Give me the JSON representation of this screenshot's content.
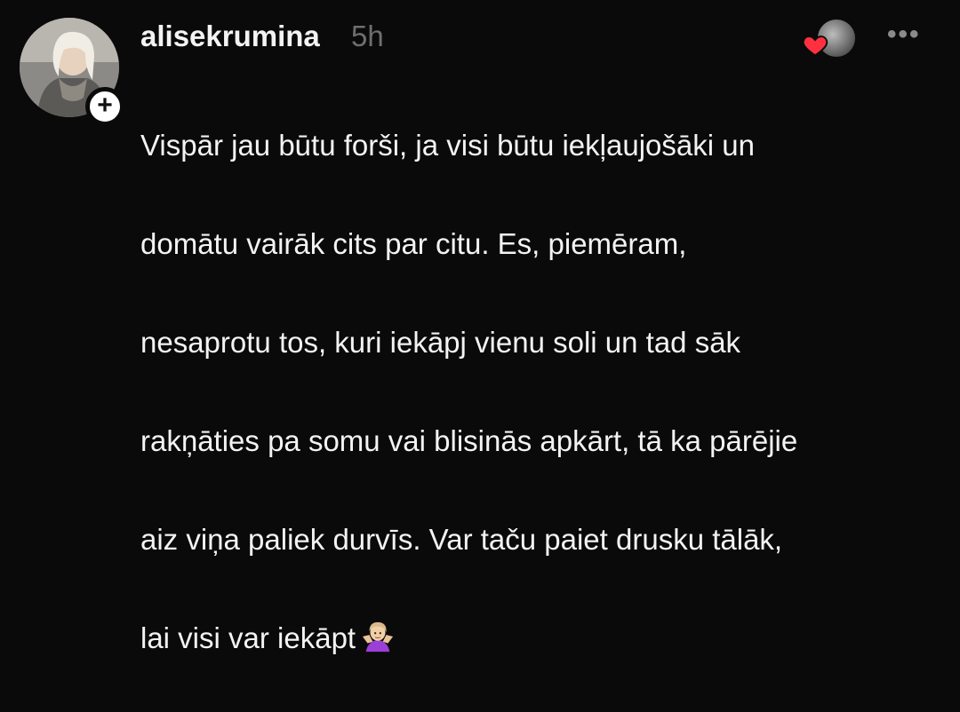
{
  "post": {
    "username": "alisekrumina",
    "timestamp": "5h",
    "more_label": "•••",
    "follow_label": "+",
    "body_lines": [
      "Vispār jau būtu forši, ja visi būtu iekļaujošāki un",
      "domātu vairāk cits par citu. Es, piemēram,",
      "nesaprotu tos, kuri iekāpj vienu soli un tad sāk",
      "rakņāties pa somu vai blisinās apkārt, tā ka pārējie",
      "aiz viņa paliek durvīs. Var taču paiet drusku tālāk,",
      "lai visi var iekāpt"
    ],
    "emoji": "shrug-woman-emoji",
    "liker_avatar_icon": "liker-avatar",
    "heart_icon": "heart-icon",
    "colors": {
      "background": "#0a0a0a",
      "text": "#f3f3f3",
      "muted": "#6e6e6e",
      "heart": "#ff3040"
    }
  }
}
